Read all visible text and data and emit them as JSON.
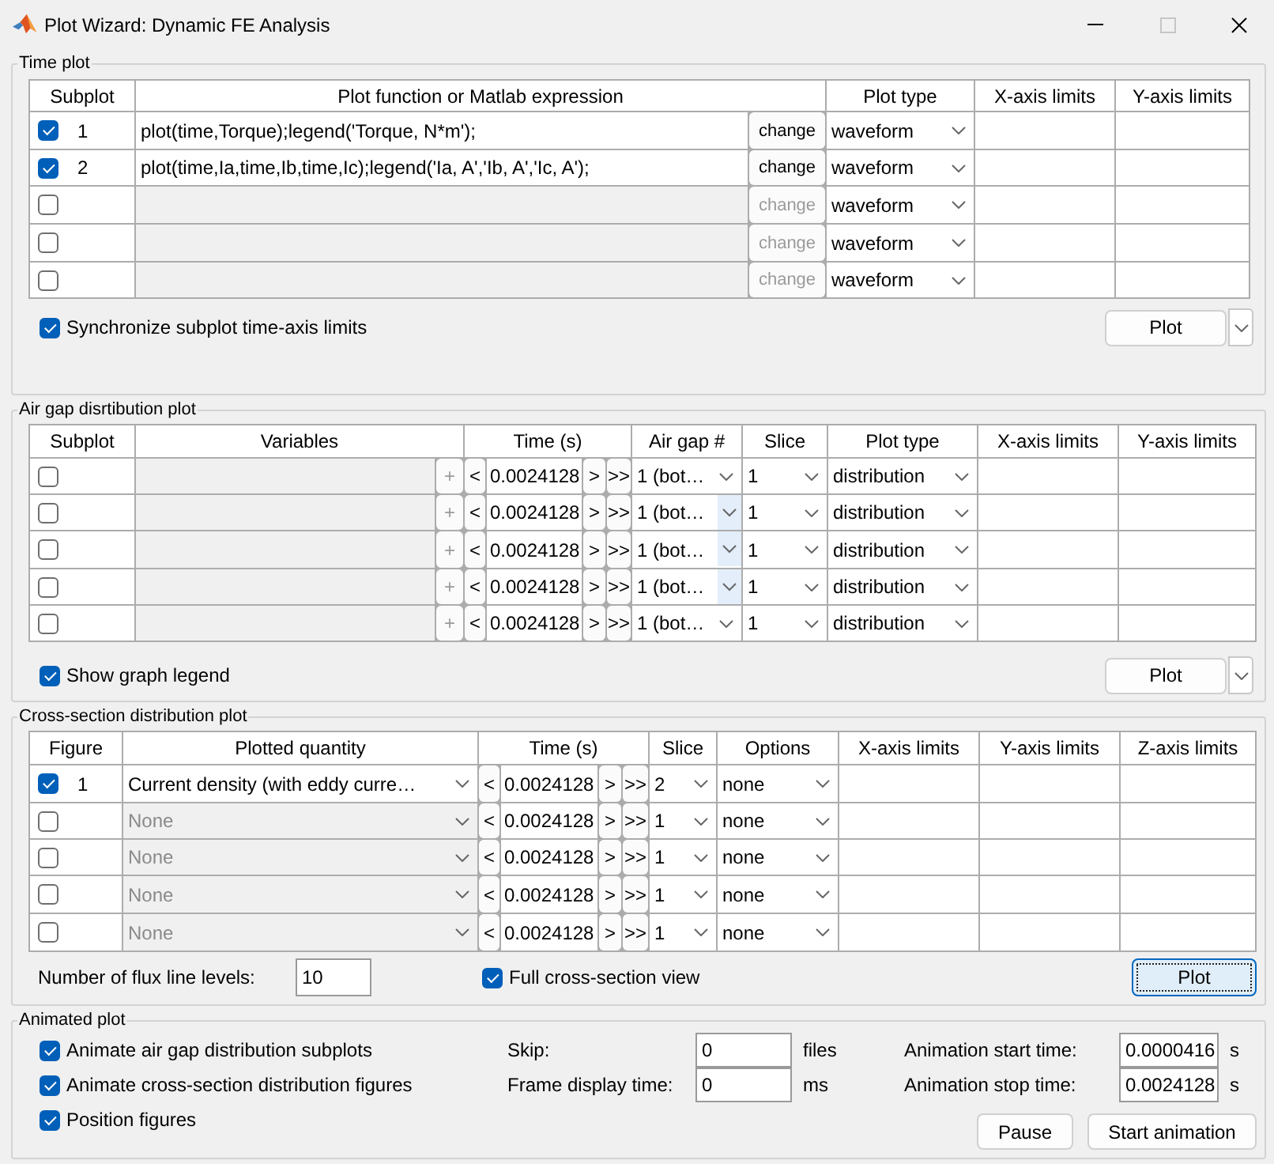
{
  "window": {
    "title": "Plot Wizard: Dynamic FE Analysis",
    "maximize_disabled": true
  },
  "time_plot": {
    "title": "Time plot",
    "columns": [
      "Subplot",
      "Plot function or Matlab expression",
      "Plot type",
      "X-axis limits",
      "Y-axis limits"
    ],
    "rows": [
      {
        "checked": true,
        "subplot": "1",
        "expression": "plot(time,Torque);legend('Torque, N*m');",
        "disabled": false,
        "change_button": "change",
        "plot_type": "waveform"
      },
      {
        "checked": true,
        "subplot": "2",
        "expression": "plot(time,Ia,time,Ib,time,Ic);legend('Ia, A','Ib, A','Ic, A');",
        "disabled": false,
        "change_button": "change",
        "plot_type": "waveform"
      },
      {
        "checked": false,
        "disabled": true,
        "change_button": "change",
        "plot_type": "waveform"
      },
      {
        "checked": false,
        "disabled": true,
        "change_button": "change",
        "plot_type": "waveform"
      },
      {
        "checked": false,
        "disabled": true,
        "change_button": "change",
        "plot_type": "waveform"
      }
    ],
    "sync": {
      "label": "Synchronize subplot time-axis limits",
      "checked": true
    },
    "plot_button": {
      "label": "Plot",
      "menu": true
    }
  },
  "air_gap_plot": {
    "title": "Air gap disrtibution plot",
    "columns": [
      "Subplot",
      "Variables",
      "Time (s)",
      "Air gap #",
      "Slice",
      "Plot type",
      "X-axis limits",
      "Y-axis limits"
    ],
    "rows": [
      {
        "checked": false,
        "disabled": true,
        "add_button": "+",
        "prev_button": "<",
        "time": "0.0024128",
        "next_button": ">",
        "last_button": ">>",
        "air_gap": "1 (bot…",
        "arrow_highlighted": false,
        "slice": "1",
        "plot_type": "distribution"
      },
      {
        "checked": false,
        "disabled": true,
        "add_button": "+",
        "prev_button": "<",
        "time": "0.0024128",
        "next_button": ">",
        "last_button": ">>",
        "air_gap": "1 (bot…",
        "arrow_highlighted": true,
        "slice": "1",
        "plot_type": "distribution"
      },
      {
        "checked": false,
        "disabled": true,
        "add_button": "+",
        "prev_button": "<",
        "time": "0.0024128",
        "next_button": ">",
        "last_button": ">>",
        "air_gap": "1 (bot…",
        "arrow_highlighted": true,
        "slice": "1",
        "plot_type": "distribution"
      },
      {
        "checked": false,
        "disabled": true,
        "add_button": "+",
        "prev_button": "<",
        "time": "0.0024128",
        "next_button": ">",
        "last_button": ">>",
        "air_gap": "1 (bot…",
        "arrow_highlighted": true,
        "slice": "1",
        "plot_type": "distribution"
      },
      {
        "checked": false,
        "disabled": true,
        "add_button": "+",
        "prev_button": "<",
        "time": "0.0024128",
        "next_button": ">",
        "last_button": ">>",
        "air_gap": "1 (bot…",
        "arrow_highlighted": false,
        "slice": "1",
        "plot_type": "distribution"
      }
    ],
    "legend_option": {
      "label": "Show graph legend",
      "checked": true
    },
    "plot_button": {
      "label": "Plot",
      "menu": true
    }
  },
  "cross_section_plot": {
    "title": "Cross-section distribution plot",
    "columns": [
      "Figure",
      "Plotted quantity",
      "Time (s)",
      "Slice",
      "Options",
      "X-axis limits",
      "Y-axis limits",
      "Z-axis limits"
    ],
    "rows": [
      {
        "checked": true,
        "figure": "1",
        "quantity": "Current density (with eddy curre…",
        "disabled": false,
        "prev_button": "<",
        "time": "0.0024128",
        "next_button": ">",
        "last_button": ">>",
        "slice": "2",
        "options": "none"
      },
      {
        "checked": false,
        "quantity": "None",
        "disabled": true,
        "prev_button": "<",
        "time": "0.0024128",
        "next_button": ">",
        "last_button": ">>",
        "slice": "1",
        "options": "none"
      },
      {
        "checked": false,
        "quantity": "None",
        "disabled": true,
        "prev_button": "<",
        "time": "0.0024128",
        "next_button": ">",
        "last_button": ">>",
        "slice": "1",
        "options": "none"
      },
      {
        "checked": false,
        "quantity": "None",
        "disabled": true,
        "prev_button": "<",
        "time": "0.0024128",
        "next_button": ">",
        "last_button": ">>",
        "slice": "1",
        "options": "none"
      },
      {
        "checked": false,
        "quantity": "None",
        "disabled": true,
        "prev_button": "<",
        "time": "0.0024128",
        "next_button": ">",
        "last_button": ">>",
        "slice": "1",
        "options": "none"
      }
    ],
    "flux_levels": {
      "label": "Number of flux line levels:",
      "value": "10"
    },
    "full_view": {
      "label": "Full cross-section view",
      "checked": true
    },
    "plot_button": {
      "label": "Plot",
      "focused": true
    }
  },
  "animated_plot": {
    "title": "Animated plot",
    "options": [
      {
        "label": "Animate air gap distribution subplots",
        "checked": true
      },
      {
        "label": "Animate cross-section distribution figures",
        "checked": true
      },
      {
        "label": "Position figures",
        "checked": true
      }
    ],
    "skip": {
      "label": "Skip:",
      "value": "0",
      "unit": "files"
    },
    "frame_time": {
      "label": "Frame display time:",
      "value": "0",
      "unit": "ms"
    },
    "start_time": {
      "label": "Animation start time:",
      "value": "0.0000416",
      "unit": "s"
    },
    "stop_time": {
      "label": "Animation stop time:",
      "value": "0.0024128",
      "unit": "s"
    },
    "buttons": [
      "Pause",
      "Start animation"
    ]
  }
}
